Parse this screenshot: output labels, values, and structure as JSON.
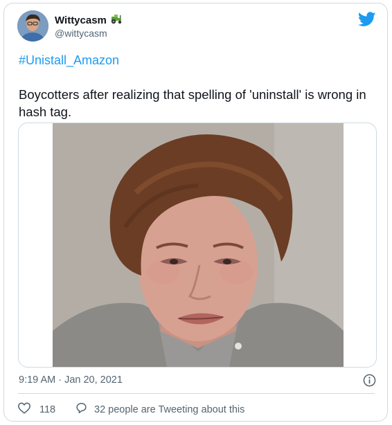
{
  "tweet": {
    "author": {
      "display_name": "Wittycasm",
      "handle": "@wittycasm",
      "badge_icon": "tractor-emoji-icon"
    },
    "hashtag": "#Unistall_Amazon",
    "text": "Boycotters after realizing that spelling of 'uninstall' is wrong in hash tag.",
    "timestamp": "9:19 AM · Jan 20, 2021",
    "likes": "118",
    "conversation_label": "32 people are Tweeting about this"
  },
  "colors": {
    "brand": "#1d9bf0",
    "text": "#0f1419",
    "secondary": "#536471",
    "border": "#cfd9de"
  }
}
